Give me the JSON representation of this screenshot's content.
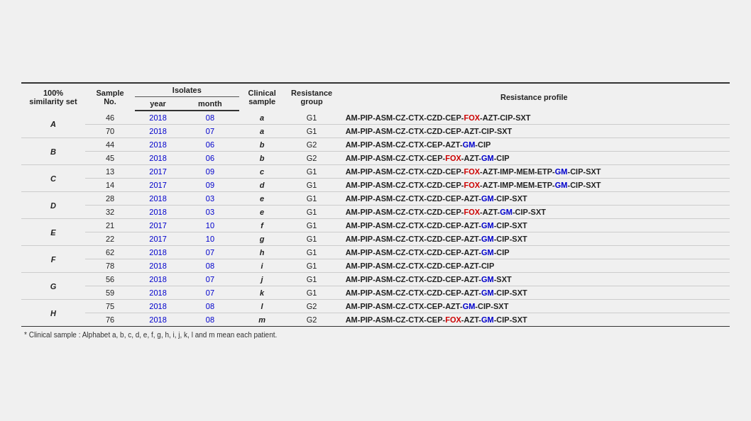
{
  "headers": {
    "col1": "100%  similarity set",
    "col2": "Sample  No.",
    "isolates": "Isolates",
    "year": "year",
    "month": "month",
    "clinical": "Clinical sample",
    "resistance_group": "Resistance group",
    "resistance_profile": "Resistance profile"
  },
  "rows": [
    {
      "set": "A",
      "rowspan": 2,
      "entries": [
        {
          "sample": "46",
          "year": "2018",
          "month": "08",
          "clinical": "a",
          "group": "G1",
          "profile_parts": [
            {
              "text": "AM-PIP-ASM-CZ-CTX-CZD-CEP-",
              "style": "bold"
            },
            {
              "text": "FOX",
              "style": "red"
            },
            {
              "text": "-AZT-CIP-SXT",
              "style": "bold"
            }
          ]
        },
        {
          "sample": "70",
          "year": "2018",
          "month": "07",
          "clinical": "a",
          "group": "G1",
          "profile_parts": [
            {
              "text": "AM-PIP-ASM-CZ-CTX-CZD-CEP-AZT-CIP-SXT",
              "style": "bold"
            }
          ]
        }
      ]
    },
    {
      "set": "B",
      "rowspan": 2,
      "entries": [
        {
          "sample": "44",
          "year": "2018",
          "month": "06",
          "clinical": "b",
          "group": "G2",
          "profile_parts": [
            {
              "text": "AM-PIP-ASM-CZ-CTX-CEP-AZT-",
              "style": "bold"
            },
            {
              "text": "GM",
              "style": "blue"
            },
            {
              "text": "-CIP",
              "style": "bold"
            }
          ]
        },
        {
          "sample": "45",
          "year": "2018",
          "month": "06",
          "clinical": "b",
          "group": "G2",
          "profile_parts": [
            {
              "text": "AM-PIP-ASM-CZ-CTX-CEP-",
              "style": "bold"
            },
            {
              "text": "FOX",
              "style": "red"
            },
            {
              "text": "-AZT-",
              "style": "bold"
            },
            {
              "text": "GM",
              "style": "blue"
            },
            {
              "text": "-CIP",
              "style": "bold"
            }
          ]
        }
      ]
    },
    {
      "set": "C",
      "rowspan": 2,
      "entries": [
        {
          "sample": "13",
          "year": "2017",
          "month": "09",
          "clinical": "c",
          "group": "G1",
          "profile_parts": [
            {
              "text": "AM-PIP-ASM-CZ-CTX-CZD-CEP-",
              "style": "bold"
            },
            {
              "text": "FOX",
              "style": "red"
            },
            {
              "text": "-AZT-IMP-MEM-ETP-",
              "style": "bold"
            },
            {
              "text": "GM",
              "style": "blue"
            },
            {
              "text": "-CIP-SXT",
              "style": "bold"
            }
          ]
        },
        {
          "sample": "14",
          "year": "2017",
          "month": "09",
          "clinical": "d",
          "group": "G1",
          "profile_parts": [
            {
              "text": "AM-PIP-ASM-CZ-CTX-CZD-CEP-",
              "style": "bold"
            },
            {
              "text": "FOX",
              "style": "red"
            },
            {
              "text": "-AZT-IMP-MEM-ETP-",
              "style": "bold"
            },
            {
              "text": "GM",
              "style": "blue"
            },
            {
              "text": "-CIP-SXT",
              "style": "bold"
            }
          ]
        }
      ]
    },
    {
      "set": "D",
      "rowspan": 2,
      "entries": [
        {
          "sample": "28",
          "year": "2018",
          "month": "03",
          "clinical": "e",
          "group": "G1",
          "profile_parts": [
            {
              "text": "AM-PIP-ASM-CZ-CTX-CZD-CEP-AZT-",
              "style": "bold"
            },
            {
              "text": "GM",
              "style": "blue"
            },
            {
              "text": "-CIP-SXT",
              "style": "bold"
            }
          ]
        },
        {
          "sample": "32",
          "year": "2018",
          "month": "03",
          "clinical": "e",
          "group": "G1",
          "profile_parts": [
            {
              "text": "AM-PIP-ASM-CZ-CTX-CZD-CEP-",
              "style": "bold"
            },
            {
              "text": "FOX",
              "style": "red"
            },
            {
              "text": "-AZT-",
              "style": "bold"
            },
            {
              "text": "GM",
              "style": "blue"
            },
            {
              "text": "-CIP-SXT",
              "style": "bold"
            }
          ]
        }
      ]
    },
    {
      "set": "E",
      "rowspan": 2,
      "entries": [
        {
          "sample": "21",
          "year": "2017",
          "month": "10",
          "clinical": "f",
          "group": "G1",
          "profile_parts": [
            {
              "text": "AM-PIP-ASM-CZ-CTX-CZD-CEP-AZT-",
              "style": "bold"
            },
            {
              "text": "GM",
              "style": "blue"
            },
            {
              "text": "-CIP-SXT",
              "style": "bold"
            }
          ]
        },
        {
          "sample": "22",
          "year": "2017",
          "month": "10",
          "clinical": "g",
          "group": "G1",
          "profile_parts": [
            {
              "text": "AM-PIP-ASM-CZ-CTX-CZD-CEP-AZT-",
              "style": "bold"
            },
            {
              "text": "GM",
              "style": "blue"
            },
            {
              "text": "-CIP-SXT",
              "style": "bold"
            }
          ]
        }
      ]
    },
    {
      "set": "F",
      "rowspan": 2,
      "entries": [
        {
          "sample": "62",
          "year": "2018",
          "month": "07",
          "clinical": "h",
          "group": "G1",
          "profile_parts": [
            {
              "text": "AM-PIP-ASM-CZ-CTX-CZD-CEP-AZT-",
              "style": "bold"
            },
            {
              "text": "GM",
              "style": "blue"
            },
            {
              "text": "-CIP",
              "style": "bold"
            }
          ]
        },
        {
          "sample": "78",
          "year": "2018",
          "month": "08",
          "clinical": "i",
          "group": "G1",
          "profile_parts": [
            {
              "text": "AM-PIP-ASM-CZ-CTX-CZD-CEP-AZT-CIP",
              "style": "bold"
            }
          ]
        }
      ]
    },
    {
      "set": "G",
      "rowspan": 2,
      "entries": [
        {
          "sample": "56",
          "year": "2018",
          "month": "07",
          "clinical": "j",
          "group": "G1",
          "profile_parts": [
            {
              "text": "AM-PIP-ASM-CZ-CTX-CZD-CEP-AZT-",
              "style": "bold"
            },
            {
              "text": "GM",
              "style": "blue"
            },
            {
              "text": "-SXT",
              "style": "bold"
            }
          ]
        },
        {
          "sample": "59",
          "year": "2018",
          "month": "07",
          "clinical": "k",
          "group": "G1",
          "profile_parts": [
            {
              "text": "AM-PIP-ASM-CZ-CTX-CZD-CEP-AZT-",
              "style": "bold"
            },
            {
              "text": "GM",
              "style": "blue"
            },
            {
              "text": "-CIP-SXT",
              "style": "bold"
            }
          ]
        }
      ]
    },
    {
      "set": "H",
      "rowspan": 2,
      "entries": [
        {
          "sample": "75",
          "year": "2018",
          "month": "08",
          "clinical": "l",
          "group": "G2",
          "profile_parts": [
            {
              "text": "AM-PIP-ASM-CZ-CTX-CEP-AZT-",
              "style": "bold"
            },
            {
              "text": "GM",
              "style": "blue"
            },
            {
              "text": "-CIP-SXT",
              "style": "bold"
            }
          ]
        },
        {
          "sample": "76",
          "year": "2018",
          "month": "08",
          "clinical": "m",
          "group": "G2",
          "profile_parts": [
            {
              "text": "AM-PIP-ASM-CZ-CTX-CEP-",
              "style": "bold"
            },
            {
              "text": "FOX",
              "style": "red"
            },
            {
              "text": "-AZT-",
              "style": "bold"
            },
            {
              "text": "GM",
              "style": "blue"
            },
            {
              "text": "-CIP-SXT",
              "style": "bold"
            }
          ]
        }
      ]
    }
  ],
  "footnote": "* Clinical sample : Alphabet a, b, c, d, e, f, g, h, i, j, k, l and m mean each patient."
}
